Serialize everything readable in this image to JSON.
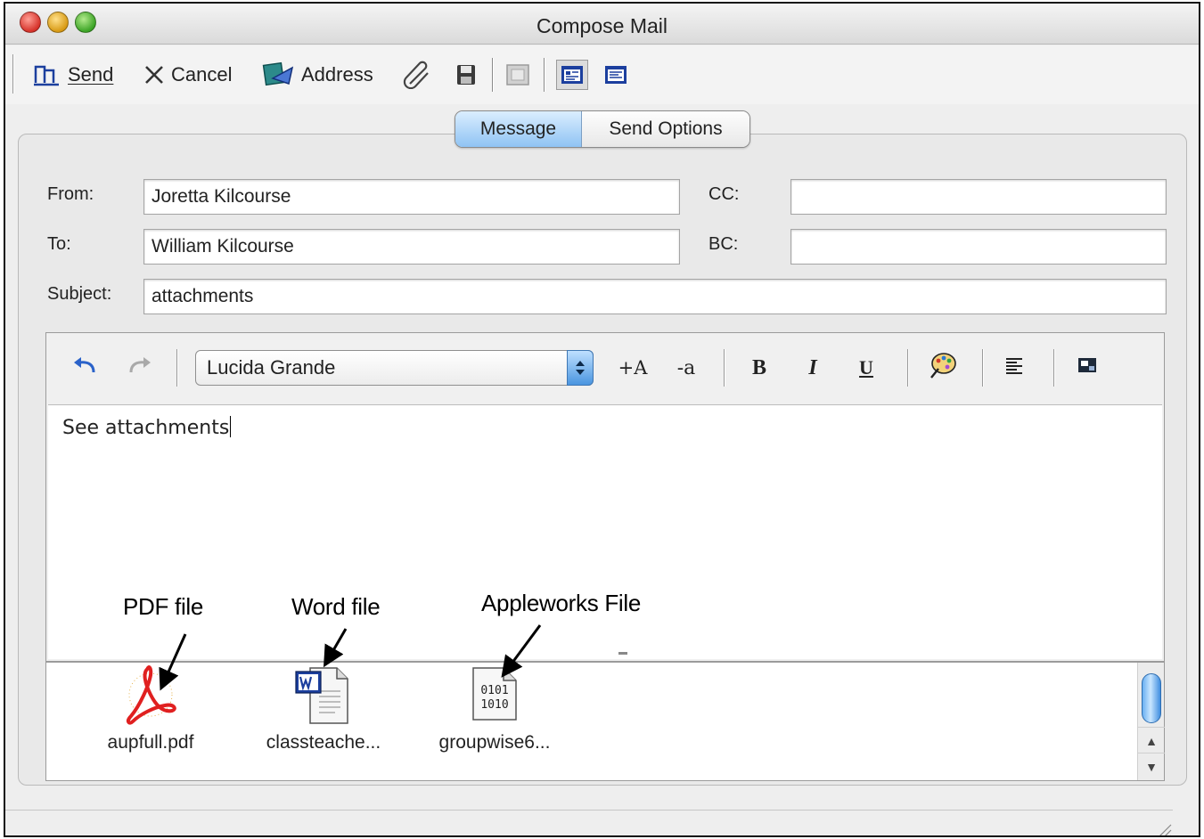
{
  "window": {
    "title": "Compose Mail"
  },
  "toolbar": {
    "send_label": "Send",
    "cancel_label": "Cancel",
    "address_label": "Address"
  },
  "tabs": [
    {
      "label": "Message",
      "active": true
    },
    {
      "label": "Send Options",
      "active": false
    }
  ],
  "fields": {
    "from": {
      "label": "From:",
      "value": "Joretta Kilcourse"
    },
    "to": {
      "label": "To:",
      "value": "William Kilcourse"
    },
    "cc": {
      "label": "CC:",
      "value": ""
    },
    "bc": {
      "label": "BC:",
      "value": ""
    },
    "subject": {
      "label": "Subject:",
      "value": "attachments"
    }
  },
  "format": {
    "font": "Lucida Grande",
    "increase_size": "+A",
    "decrease_size": "-a",
    "bold": "B",
    "italic": "I",
    "underline": "U"
  },
  "body": {
    "text": "See attachments"
  },
  "attachments": [
    {
      "name": "aupfull.pdf",
      "icon": "pdf-file-icon"
    },
    {
      "name": "classteache...",
      "icon": "word-file-icon"
    },
    {
      "name": "groupwise6...",
      "icon": "binary-file-icon",
      "glyph_line1": "0101",
      "glyph_line2": "1010"
    }
  ],
  "annotations": {
    "pdf": "PDF file",
    "word": "Word file",
    "appleworks": "Appleworks File"
  },
  "colors": {
    "tab_active": "#8fc3f3",
    "scroll_thumb": "#4a95e0",
    "pdf_red": "#e02020",
    "word_blue": "#1c3f9e",
    "close_red": "#d6322a",
    "minimize_yellow": "#d89a14",
    "zoom_green": "#3ca426"
  }
}
